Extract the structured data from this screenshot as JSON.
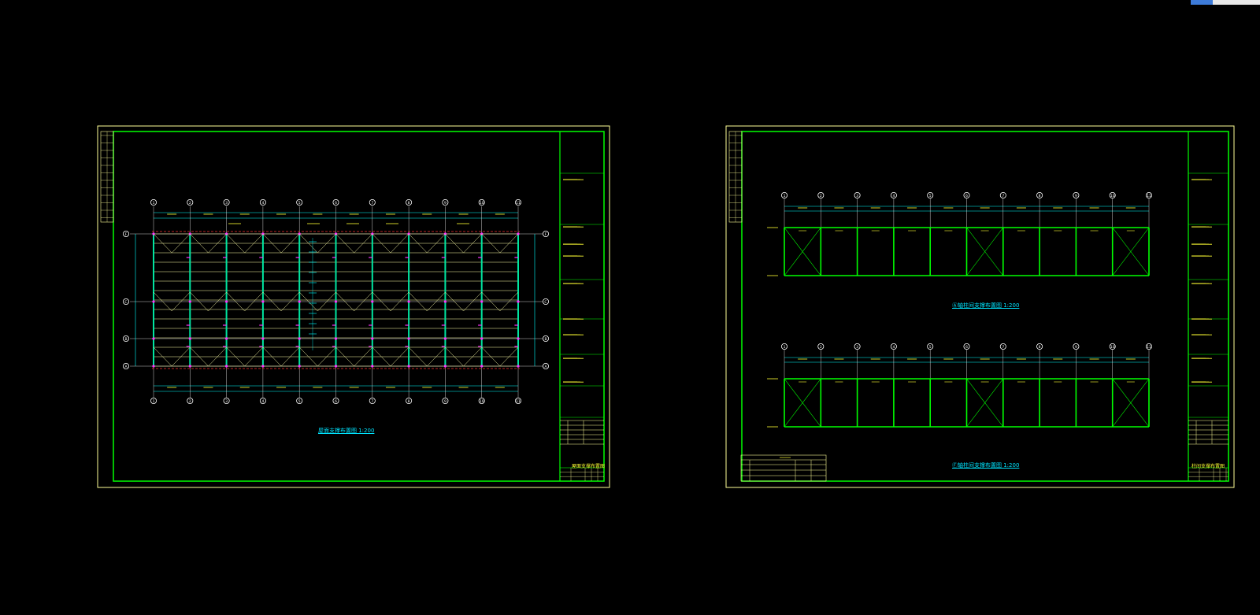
{
  "viewer": {
    "background": "#000000",
    "colors": {
      "frame": "#ffff99",
      "border": "#00ff00",
      "axis": "#ffffff",
      "beam": "#ffffaa",
      "column": "#00e5a0",
      "bracing": "#ff3030",
      "dim": "#00ffff",
      "magenta": "#ff33ff",
      "text": "#ffff33"
    },
    "zoom_control_icon": "navigation-cube-icon"
  },
  "axis_labels": [
    "1",
    "2",
    "3",
    "4",
    "5",
    "6",
    "7",
    "8",
    "9",
    "10",
    "11"
  ],
  "row_labels": [
    "F",
    "C",
    "B",
    "A"
  ],
  "sheets": [
    {
      "name": "roof-bracing-plan-sheet",
      "caption": "屋面支撑布置图 1:200",
      "title_block_name": "屋面支撑布置图"
    },
    {
      "name": "column-bracing-elevation-sheet",
      "captions": [
        "Ⓐ轴柱间支撑布置图 1:200",
        "Ⓕ轴柱间支撑布置图 1:200"
      ],
      "title_block_name": "柱间支撑布置图"
    }
  ]
}
